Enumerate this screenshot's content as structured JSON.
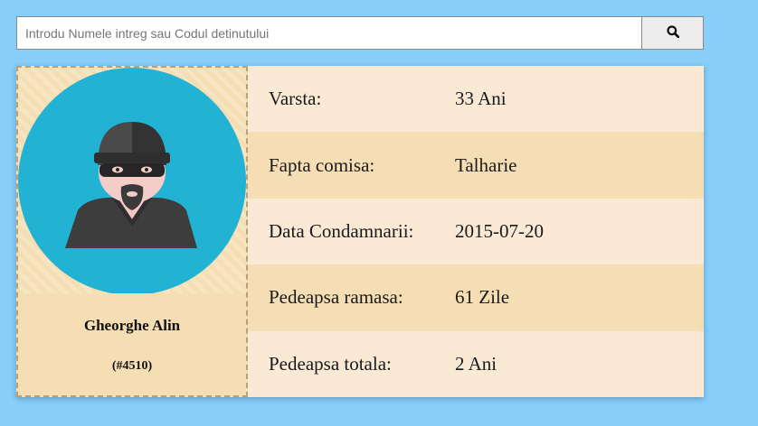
{
  "search": {
    "placeholder": "Introdu Numele intreg sau Codul detinutului",
    "value": "",
    "button_icon": "search-icon"
  },
  "profile": {
    "photo_icon": "burglar-avatar-icon",
    "name": "Gheorghe Alin",
    "code": "(#4510)"
  },
  "details": {
    "rows": [
      {
        "label": "Varsta:",
        "value": "33 Ani"
      },
      {
        "label": "Fapta comisa:",
        "value": "Talharie"
      },
      {
        "label": "Data Condamnarii:",
        "value": "2015-07-20"
      },
      {
        "label": "Pedeapsa ramasa:",
        "value": "61 Zile"
      },
      {
        "label": "Pedeapsa totala:",
        "value": "2 Ani"
      }
    ]
  },
  "colors": {
    "page_background": "#87cefa",
    "card_light": "#fae9d5",
    "card_dark": "#f5deb3",
    "avatar_circle": "#22b2d4",
    "avatar_dark": "#3d3d3d"
  }
}
